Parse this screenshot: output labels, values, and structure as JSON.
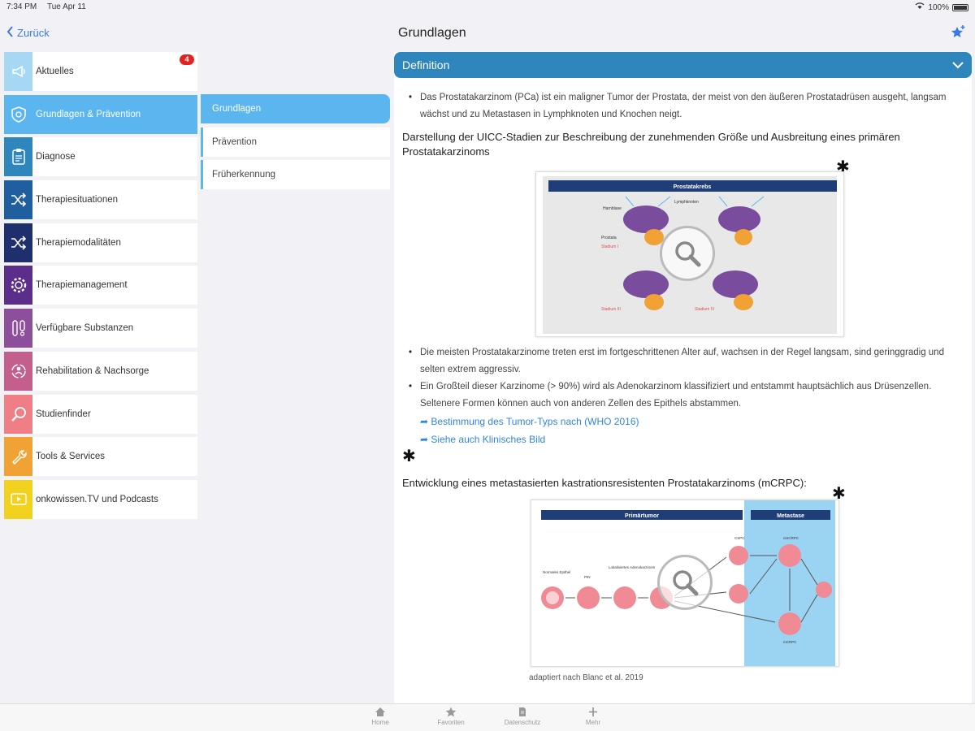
{
  "statusbar": {
    "time": "7:34 PM",
    "date": "Tue Apr 11",
    "battery": "100%"
  },
  "nav": {
    "back_label": "Zurück",
    "title": "Grundlagen"
  },
  "sidebar": {
    "items": [
      {
        "label": "Aktuelles",
        "icon": "megaphone-icon",
        "color": "#a7d8f3",
        "badge": "4"
      },
      {
        "label": "Grundlagen & Prävention",
        "icon": "shield-icon",
        "color": "#5bb5ee",
        "active": true
      },
      {
        "label": "Diagnose",
        "icon": "clipboard-icon",
        "color": "#2f86bd"
      },
      {
        "label": "Therapiesituationen",
        "icon": "shuffle-icon",
        "color": "#1f5fa0"
      },
      {
        "label": "Therapiemodalitäten",
        "icon": "shuffle-icon",
        "color": "#1f2f6e"
      },
      {
        "label": "Therapiemanagement",
        "icon": "gear-icon",
        "color": "#5b2e8c"
      },
      {
        "label": "Verfügbare Substanzen",
        "icon": "vials-icon",
        "color": "#8d4e9c"
      },
      {
        "label": "Rehabilitation & Nachsorge",
        "icon": "person-cycle-icon",
        "color": "#c45e8c"
      },
      {
        "label": "Studienfinder",
        "icon": "magnifier-icon",
        "color": "#ef7e87"
      },
      {
        "label": "Tools & Services",
        "icon": "wrench-icon",
        "color": "#f0a235"
      },
      {
        "label": "onkowissen.TV und Podcasts",
        "icon": "play-icon",
        "color": "#f2d21f"
      }
    ]
  },
  "subnav": {
    "items": [
      {
        "label": "Grundlagen",
        "active": true
      },
      {
        "label": "Prävention"
      },
      {
        "label": "Früherkennung"
      }
    ]
  },
  "content": {
    "section_header": "Definition",
    "bullet1": "Das Prostatakarzinom (PCa) ist ein maligner Tumor der Prostata, der meist von den äußeren Prostatadrüsen ausgeht, langsam wächst und zu Metastasen in Lymphknoten und Knochen neigt.",
    "heading1": "Darstellung der UICC-Stadien zur Beschreibung der zunehmenden Größe und Ausbreitung eines primären Prostatakarzinoms",
    "figure1": {
      "title": "Prostatakrebs",
      "labels": [
        "Lymphknoten",
        "Harnblase",
        "Prostata",
        "Stadium I",
        "Stadium II",
        "Stadium III",
        "Stadium IV"
      ]
    },
    "bullet2": "Die meisten Prostatakarzinome treten erst im fortgeschrittenen Alter auf, wachsen in der Regel langsam, sind geringgradig und selten extrem aggressiv.",
    "bullet3": "Ein Großteil dieser Karzinome (> 90%) wird als Adenokarzinom klassifiziert und entstammt hauptsächlich aus Drüsenzellen. Seltenere Formen können auch von anderen Zellen des Epithels abstammen.",
    "link1": "Bestimmung des Tumor-Typs nach (WHO 2016)",
    "link2": "Siehe auch Klinisches Bild",
    "heading2": "Entwicklung eines metastasierten kastrationsresistenten Prostatakarzinoms (mCRPC):",
    "figure2": {
      "title_left": "Primärtumor",
      "title_right": "Metastase",
      "labels": [
        "Normales Epithel",
        "PIN",
        "Lokalisiertes Adenokarzinom",
        "Lymphknoten",
        "Rezidiv",
        "CSPC",
        "Therapiebedingte Kastrationsresistenz",
        "mHSPC",
        "Schnelle Kastrationsresistenz",
        "nmCRPC",
        "Rezidiv",
        "ADT + Chemo",
        "mCRPC"
      ]
    },
    "caption": "adaptiert nach Blanc et al. 2019"
  },
  "tabbar": {
    "items": [
      {
        "label": "Home",
        "icon": "home-icon"
      },
      {
        "label": "Favoriten",
        "icon": "star-icon"
      },
      {
        "label": "Datenschutz",
        "icon": "document-icon"
      },
      {
        "label": "Mehr",
        "icon": "plus-icon"
      }
    ]
  }
}
